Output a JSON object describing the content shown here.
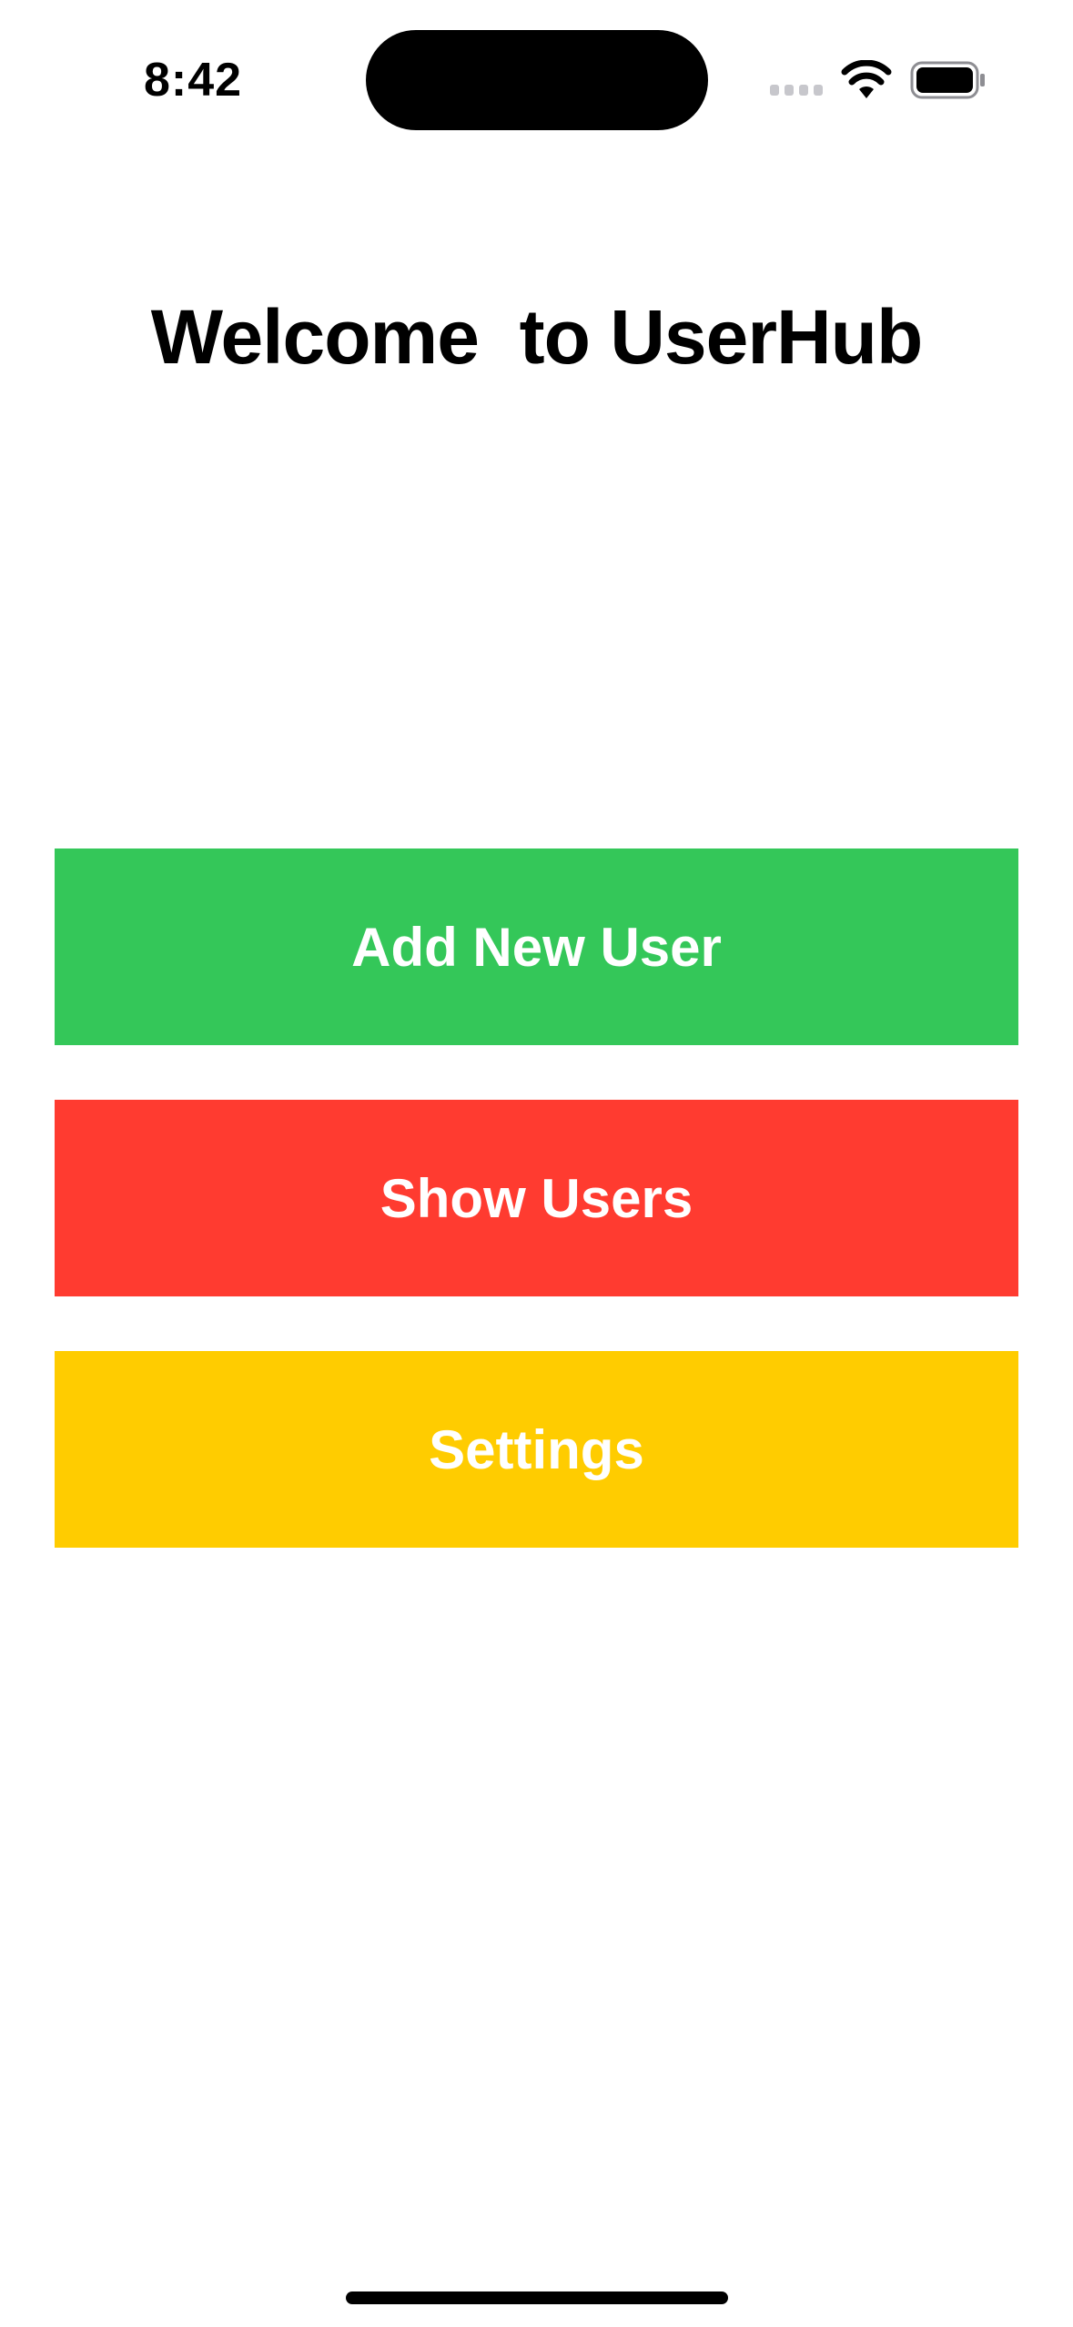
{
  "status_bar": {
    "time": "8:42",
    "icons": [
      "cellular-signal-icon",
      "wifi-icon",
      "battery-icon"
    ]
  },
  "main": {
    "title": "Welcome  to UserHub",
    "buttons": [
      {
        "label": "Add New User",
        "color": "#34C759"
      },
      {
        "label": "Show Users",
        "color": "#FF3B30"
      },
      {
        "label": "Settings",
        "color": "#FFCC00"
      }
    ]
  }
}
